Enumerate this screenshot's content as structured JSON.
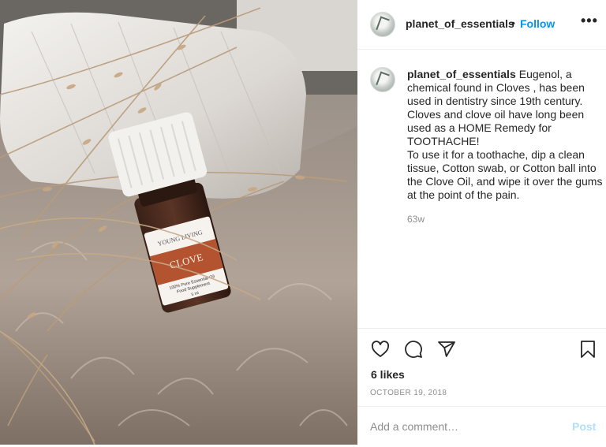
{
  "photo": {
    "label_brand": "YOUNG LIVING",
    "label_product": "CLOVE",
    "label_line1": "100% Pure Essential Oil",
    "label_line2": "Food Supplement",
    "label_size": "5 ml"
  },
  "header": {
    "username": "planet_of_essentials",
    "separator": "•",
    "follow_label": "Follow",
    "more_label": "•••"
  },
  "caption": {
    "username": "planet_of_essentials",
    "text": "Eugenol, a chemical found in Cloves , has been used in dentistry since 19th century. Cloves and clove oil have long been used as a HOME Remedy for TOOTHACHE!\nTo use it for a toothache, dip a clean tissue, Cotton swab, or Cotton ball into the Clove Oil, and wipe it over the gums at the point of the pain.",
    "age": "63w"
  },
  "engagement": {
    "likes": "6 likes",
    "date": "OCTOBER 19, 2018"
  },
  "comment": {
    "placeholder": "Add a comment…",
    "post_label": "Post"
  },
  "icons": {
    "like": "heart-icon",
    "comment": "speech-bubble-icon",
    "share": "paper-plane-icon",
    "save": "bookmark-icon"
  },
  "colors": {
    "accent": "#0095f6",
    "post_disabled": "#b2dffc",
    "muted": "#8e8e8e"
  }
}
